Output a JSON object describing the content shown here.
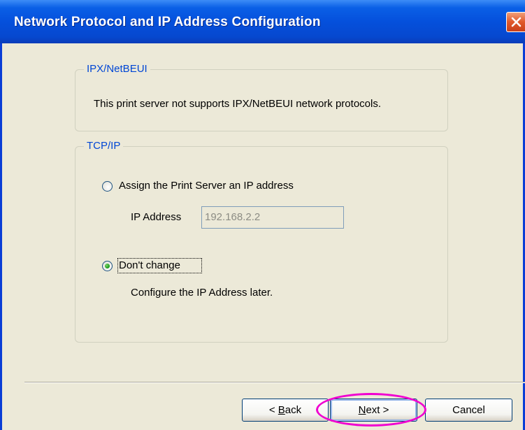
{
  "window": {
    "title": "Network Protocol and IP Address Configuration"
  },
  "ipx_group": {
    "legend": "IPX/NetBEUI",
    "message": "This print server not supports IPX/NetBEUI network protocols."
  },
  "tcpip_group": {
    "legend": "TCP/IP",
    "assign_option": {
      "label": "Assign the Print Server an IP address",
      "selected": false
    },
    "ip_address": {
      "label": "IP Address",
      "value": "192.168.2.2",
      "enabled": false
    },
    "dont_change_option": {
      "label": "Don't change",
      "selected": true
    },
    "later_note": "Configure the IP Address later."
  },
  "buttons": {
    "back": {
      "prefix": "< ",
      "mnemonic": "B",
      "rest": "ack"
    },
    "next": {
      "mnemonic": "N",
      "rest": "ext >"
    },
    "cancel": "Cancel"
  },
  "colors": {
    "titlebar": "#0550dc",
    "dialog_bg": "#ece9d8",
    "legend_text": "#0046d5",
    "highlight": "#f000d0"
  }
}
